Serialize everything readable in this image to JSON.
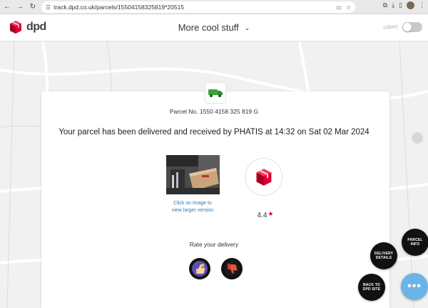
{
  "browser": {
    "url": "track.dpd.co.uk/parcels/15504158325819*20515",
    "icons": [
      "back-arrow-icon",
      "forward-arrow-icon",
      "reload-icon",
      "site-info-icon",
      "cast-icon",
      "bookmark-star-icon",
      "extensions-icon",
      "download-icon",
      "side-panel-icon",
      "profile-avatar"
    ]
  },
  "header": {
    "logo_text": "dpd",
    "parcel_name": "More cool stuff",
    "theme_label": "LIGHT"
  },
  "card": {
    "parcel_number": "Parcel No. 1550 4158 325 819 G",
    "headline": "Your parcel has been delivered and received by PHATIS at 14:32 on Sat 02 Mar 2024",
    "photo_hint_line1": "Click on image to",
    "photo_hint_line2": "view larger version",
    "rating_value": "4.4",
    "rating_star": "★",
    "rate_label": "Rate your delivery"
  },
  "fab": {
    "parcel_info_line1": "PARCEL",
    "parcel_info_line2": "INFO",
    "delivery_details_line1": "DELIVERY",
    "delivery_details_line2": "DETAILS",
    "back_line1": "BACK TO",
    "back_line2": "DPD SITE",
    "more": "•••"
  },
  "colors": {
    "brand_red": "#dc0032",
    "fab_blue": "#6ab4e6",
    "link_blue": "#2a7ab8"
  }
}
